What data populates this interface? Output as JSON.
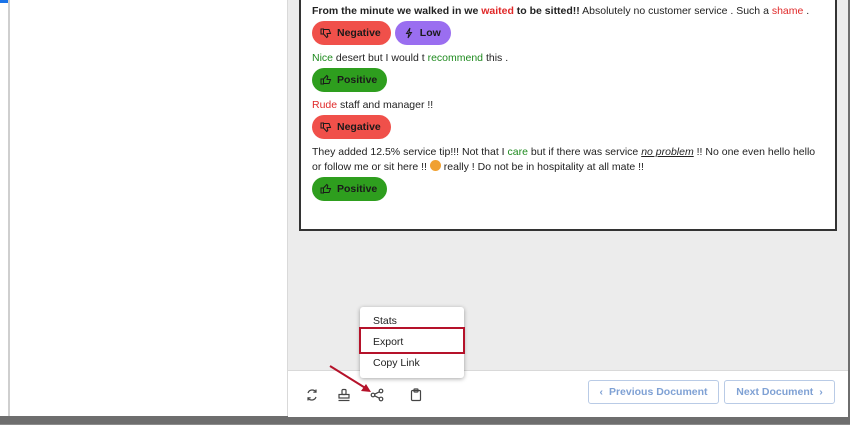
{
  "document": {
    "sentences": [
      {
        "parts": [
          {
            "text": "From the minute we walked in we ",
            "style": "bold"
          },
          {
            "text": "waited",
            "style": "bold-neg"
          },
          {
            "text": " to be sitted!!",
            "style": "bold"
          },
          {
            "text": " Absolutely no customer service . Such a ",
            "style": "plain"
          },
          {
            "text": "shame",
            "style": "neg"
          },
          {
            "text": " .",
            "style": "plain"
          }
        ],
        "pills": [
          {
            "label": "Negative",
            "kind": "negative"
          },
          {
            "label": "Low",
            "kind": "low"
          }
        ]
      },
      {
        "parts": [
          {
            "text": "Nice",
            "style": "pos"
          },
          {
            "text": " desert but I would t ",
            "style": "plain"
          },
          {
            "text": "recommend",
            "style": "pos"
          },
          {
            "text": " this .",
            "style": "plain"
          }
        ],
        "pills": [
          {
            "label": "Positive",
            "kind": "positive"
          }
        ]
      },
      {
        "parts": [
          {
            "text": "Rude",
            "style": "neg"
          },
          {
            "text": " staff and manager !!",
            "style": "plain"
          }
        ],
        "pills": [
          {
            "label": "Negative",
            "kind": "negative"
          }
        ]
      },
      {
        "parts": [
          {
            "text": "They added 12.5% service tip!!! Not that I ",
            "style": "plain"
          },
          {
            "text": "care",
            "style": "pos"
          },
          {
            "text": " but if there was service ",
            "style": "plain"
          },
          {
            "text": "no problem",
            "style": "underline"
          },
          {
            "text": " !! No one even hello hello or follow me or sit here !! ",
            "style": "plain"
          },
          {
            "text": "",
            "style": "emoji"
          },
          {
            "text": " really ! Do not be in hospitality at all mate !!",
            "style": "plain"
          }
        ],
        "pills": [
          {
            "label": "Positive",
            "kind": "positive"
          }
        ]
      }
    ]
  },
  "menu": {
    "items": [
      "Stats",
      "Export",
      "Copy Link"
    ],
    "highlighted": "Export"
  },
  "footer": {
    "icons": [
      "sync-icon",
      "stamp-icon",
      "share-icon",
      "clipboard-icon"
    ],
    "prev_label": "Previous Document",
    "next_label": "Next Document",
    "prev_chevron": "‹",
    "next_chevron": "›"
  },
  "colors": {
    "negative": "#f0504a",
    "positive": "#2e9e1e",
    "low": "#9a6ef0",
    "highlight_box": "#b5122a",
    "arrow": "#b5122a"
  }
}
